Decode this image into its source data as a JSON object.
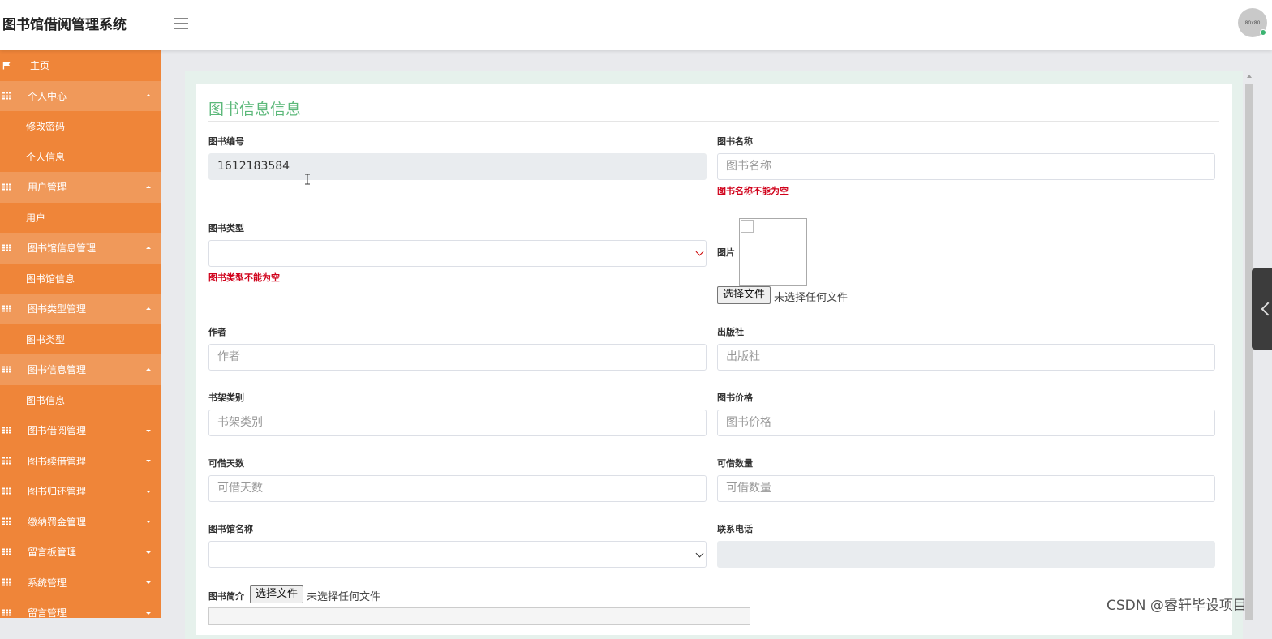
{
  "header": {
    "app_title": "图书馆借阅管理系统",
    "avatar_text": "80x80"
  },
  "sidebar": {
    "items": [
      {
        "label": "主页"
      },
      {
        "label": "个人中心"
      },
      {
        "label": "修改密码"
      },
      {
        "label": "个人信息"
      },
      {
        "label": "用户管理"
      },
      {
        "label": "用户"
      },
      {
        "label": "图书馆信息管理"
      },
      {
        "label": "图书馆信息"
      },
      {
        "label": "图书类型管理"
      },
      {
        "label": "图书类型"
      },
      {
        "label": "图书信息管理"
      },
      {
        "label": "图书信息"
      },
      {
        "label": "图书借阅管理"
      },
      {
        "label": "图书续借管理"
      },
      {
        "label": "图书归还管理"
      },
      {
        "label": "缴纳罚金管理"
      },
      {
        "label": "留言板管理"
      },
      {
        "label": "系统管理"
      },
      {
        "label": "留言管理"
      }
    ]
  },
  "form": {
    "title": "图书信息信息",
    "book_no": {
      "label": "图书编号",
      "value": "1612183584"
    },
    "book_name": {
      "label": "图书名称",
      "placeholder": "图书名称",
      "error": "图书名称不能为空"
    },
    "book_type": {
      "label": "图书类型",
      "error": "图书类型不能为空"
    },
    "image": {
      "label": "图片",
      "button": "选择文件",
      "status": "未选择任何文件"
    },
    "author": {
      "label": "作者",
      "placeholder": "作者"
    },
    "publisher": {
      "label": "出版社",
      "placeholder": "出版社"
    },
    "shelf": {
      "label": "书架类别",
      "placeholder": "书架类别"
    },
    "price": {
      "label": "图书价格",
      "placeholder": "图书价格"
    },
    "days": {
      "label": "可借天数",
      "placeholder": "可借天数"
    },
    "quantity": {
      "label": "可借数量",
      "placeholder": "可借数量"
    },
    "library_name": {
      "label": "图书馆名称"
    },
    "phone": {
      "label": "联系电话"
    },
    "intro": {
      "label": "图书简介",
      "button": "选择文件",
      "status": "未选择任何文件"
    }
  },
  "watermark": "CSDN @睿轩毕设项目"
}
